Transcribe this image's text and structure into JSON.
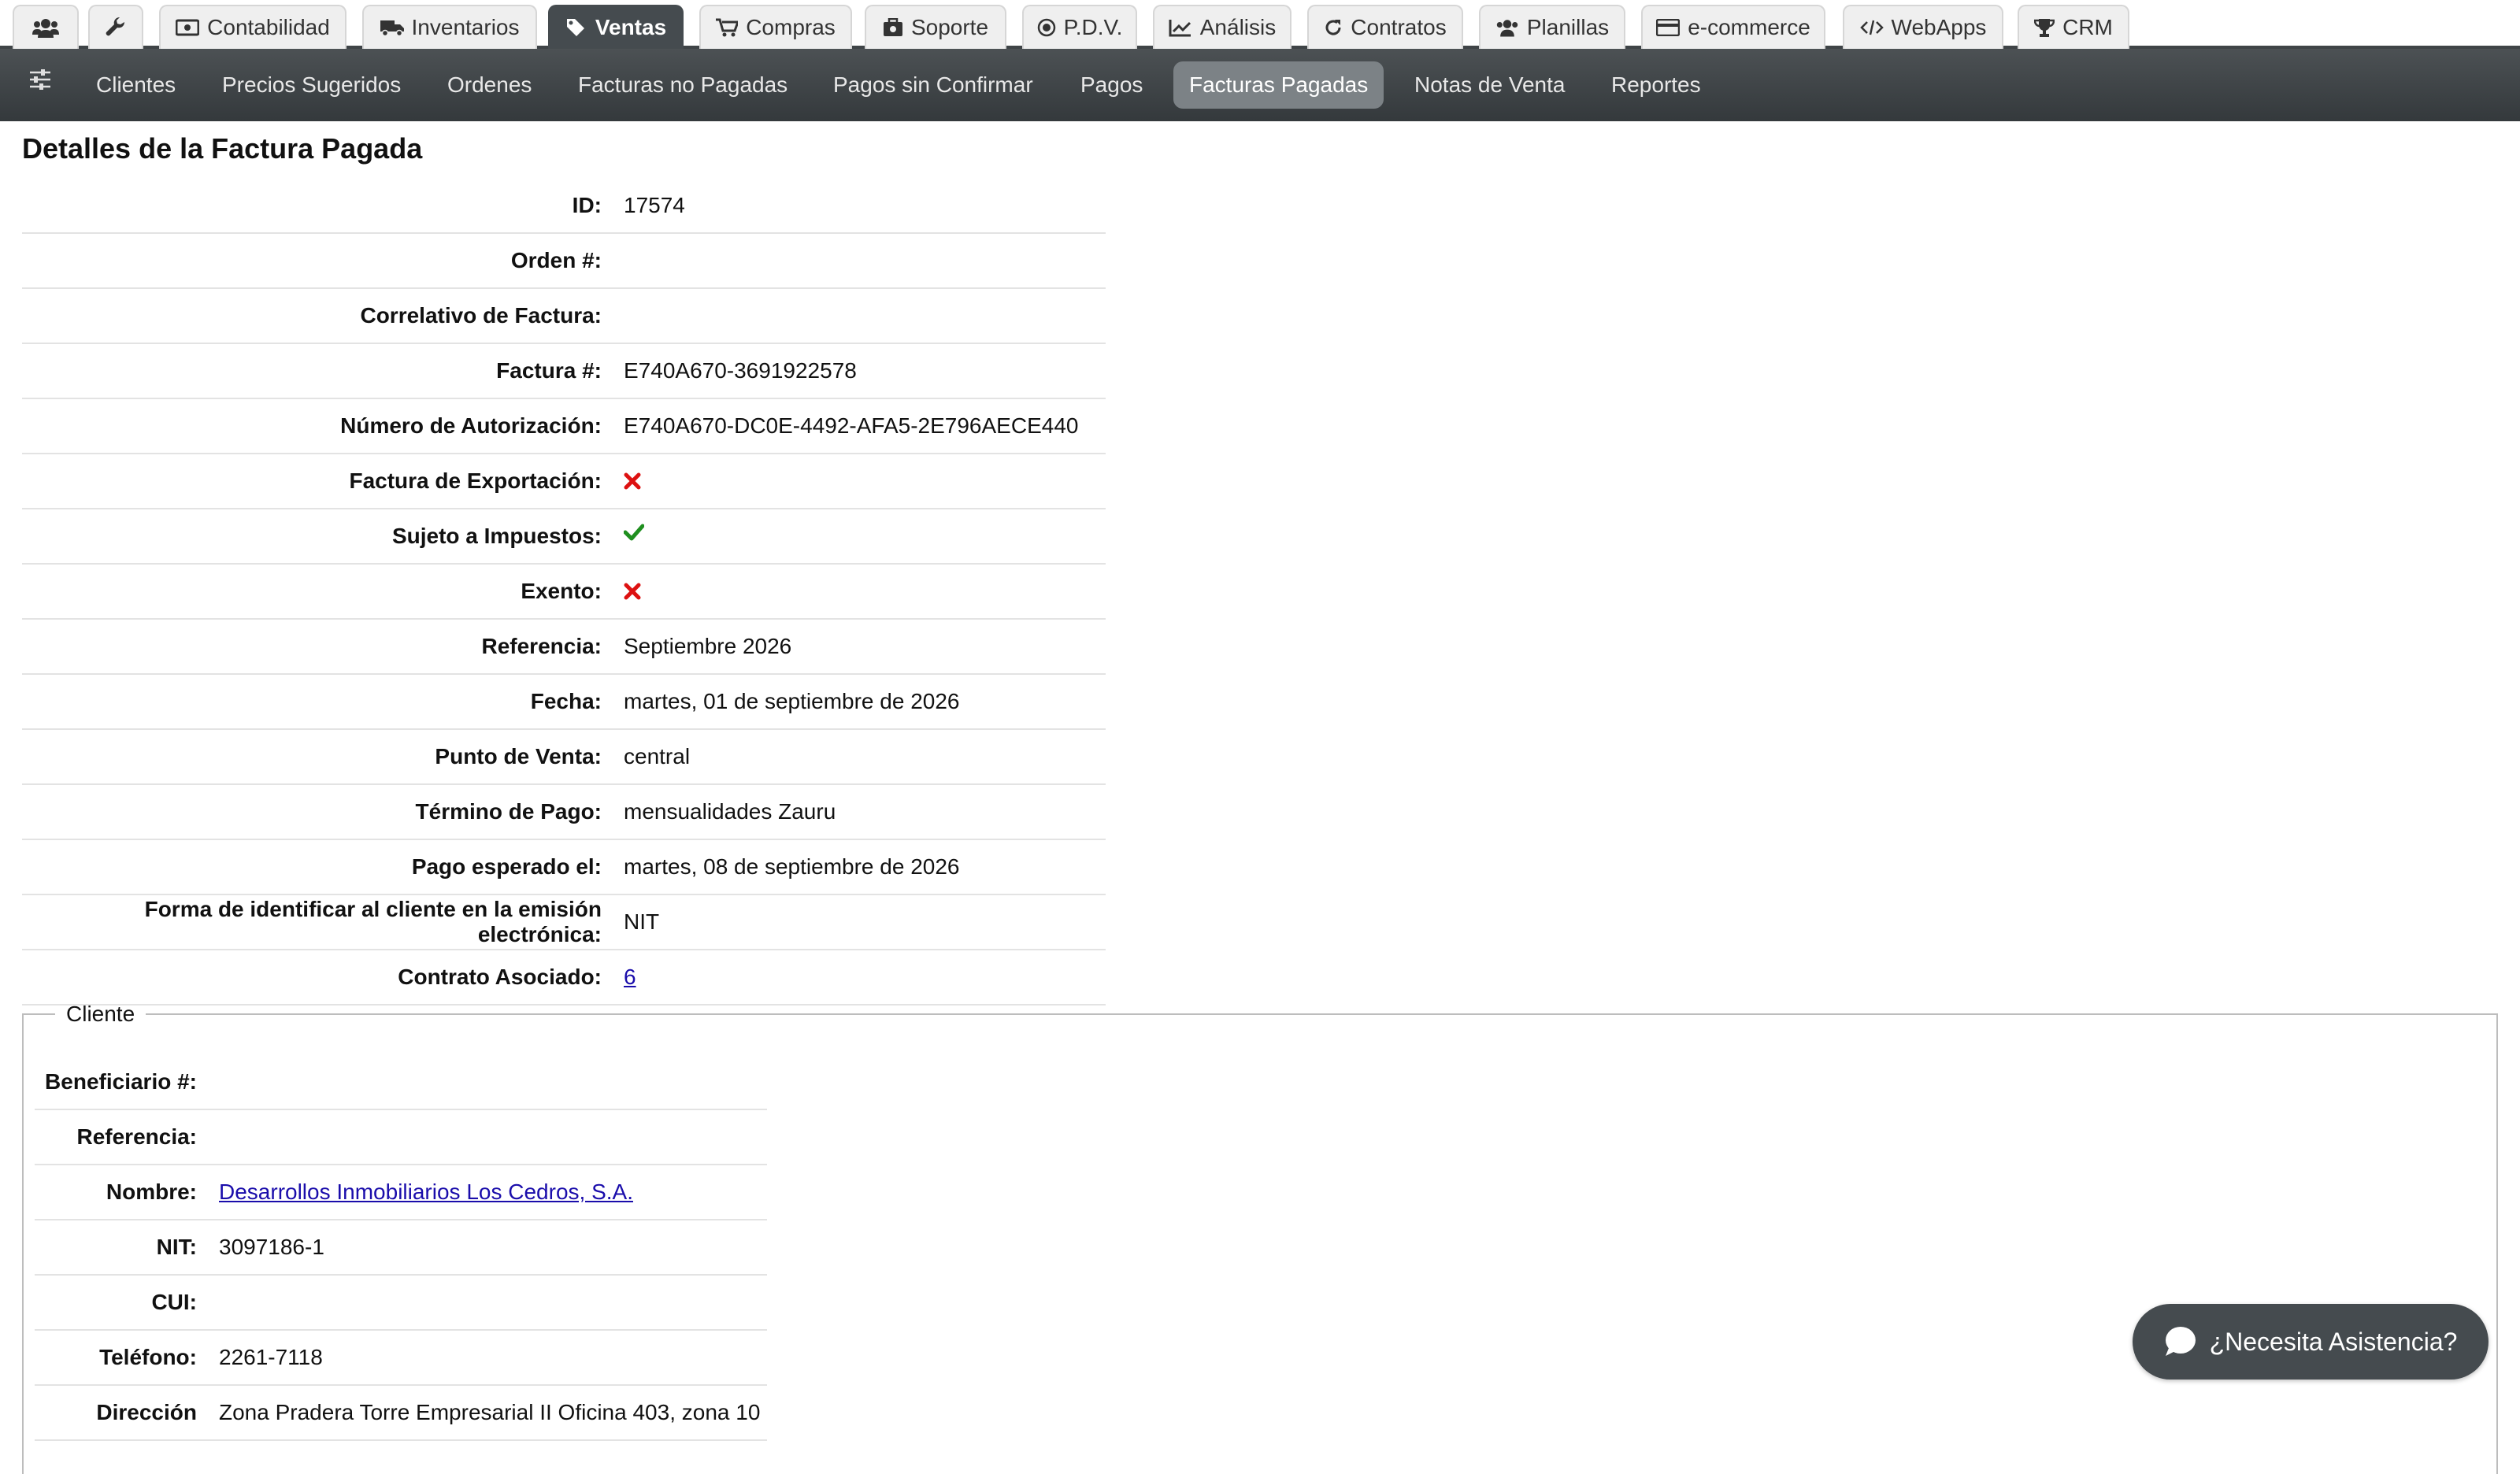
{
  "tabs": {
    "contabilidad": "Contabilidad",
    "inventarios": "Inventarios",
    "ventas": "Ventas",
    "compras": "Compras",
    "soporte": "Soporte",
    "pdv": "P.D.V.",
    "analisis": "Análisis",
    "contratos": "Contratos",
    "planillas": "Planillas",
    "ecommerce": "e-commerce",
    "webapps": "WebApps",
    "crm": "CRM"
  },
  "subnav": {
    "clientes": "Clientes",
    "precios": "Precios Sugeridos",
    "ordenes": "Ordenes",
    "no_pagadas": "Facturas no Pagadas",
    "sin_confirmar": "Pagos sin Confirmar",
    "pagos": "Pagos",
    "pagadas": "Facturas Pagadas",
    "notas": "Notas de Venta",
    "reportes": "Reportes"
  },
  "page_title": "Detalles de la Factura Pagada",
  "details": {
    "id": {
      "label": "ID:",
      "value": "17574"
    },
    "orden": {
      "label": "Orden #:",
      "value": ""
    },
    "correlativo": {
      "label": "Correlativo de Factura:",
      "value": ""
    },
    "factura": {
      "label": "Factura #:",
      "value": "E740A670-3691922578"
    },
    "autorizacion": {
      "label": "Número de Autorización:",
      "value": "E740A670-DC0E-4492-AFA5-2E796AECE440"
    },
    "exportacion": {
      "label": "Factura de Exportación:",
      "value": false
    },
    "impuestos": {
      "label": "Sujeto a Impuestos:",
      "value": true
    },
    "exento": {
      "label": "Exento:",
      "value": false
    },
    "referencia": {
      "label": "Referencia:",
      "value": "Septiembre 2026"
    },
    "fecha": {
      "label": "Fecha:",
      "value": "martes, 01 de septiembre de 2026"
    },
    "punto_venta": {
      "label": "Punto de Venta:",
      "value": "central"
    },
    "termino_pago": {
      "label": "Término de Pago:",
      "value": "mensualidades Zauru"
    },
    "pago_esperado": {
      "label": "Pago esperado el:",
      "value": "martes, 08 de septiembre de 2026"
    },
    "identificar": {
      "label": "Forma de identificar al cliente en la emisión electrónica:",
      "value": "NIT"
    },
    "contrato": {
      "label": "Contrato Asociado:",
      "value": "6"
    }
  },
  "cliente": {
    "legend": "Cliente",
    "beneficiario": {
      "label": "Beneficiario #:",
      "value": ""
    },
    "referencia": {
      "label": "Referencia:",
      "value": ""
    },
    "nombre": {
      "label": "Nombre:",
      "value": "Desarrollos Inmobiliarios Los Cedros, S.A."
    },
    "nit": {
      "label": "NIT:",
      "value": "3097186-1"
    },
    "cui": {
      "label": "CUI:",
      "value": ""
    },
    "telefono": {
      "label": "Teléfono:",
      "value": "2261-7118"
    },
    "direccion": {
      "label": "Dirección",
      "value": "Zona Pradera Torre Empresarial II Oficina 403, zona 10"
    }
  },
  "assist_label": "¿Necesita Asistencia?",
  "colors": {
    "cross": "#dd1111",
    "check": "#1f8f1f",
    "nav_dark": "#454b4f",
    "link": "#1a0dab"
  }
}
